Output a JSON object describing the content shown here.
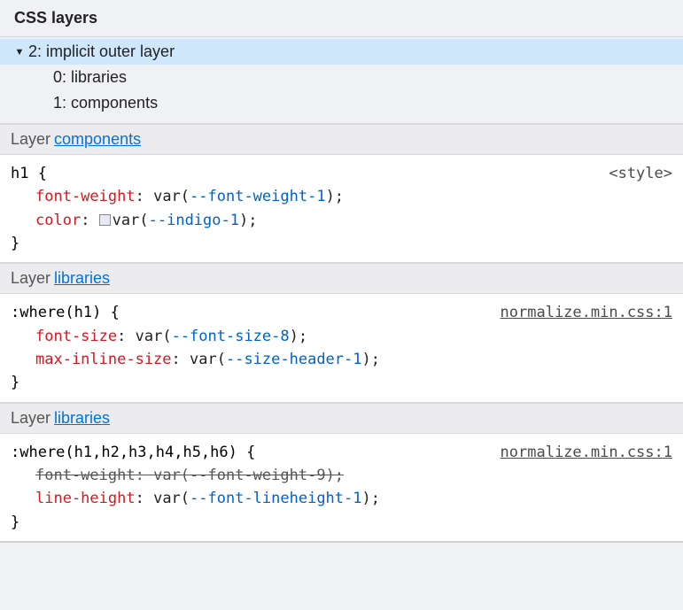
{
  "panel_title": "CSS layers",
  "tree": {
    "root": {
      "label": "2: implicit outer layer"
    },
    "children": [
      {
        "label": "0: libraries"
      },
      {
        "label": "1: components"
      }
    ]
  },
  "sections": [
    {
      "layer_prefix": "Layer ",
      "layer_name": "components",
      "selector": "h1 {",
      "source": "<style>",
      "source_kind": "tag",
      "close": "}",
      "decls": [
        {
          "prop": "font-weight",
          "val_pre": "var(",
          "var": "--font-weight-1",
          "val_post": ");",
          "swatch": false,
          "struck": false
        },
        {
          "prop": "color",
          "val_pre": "var(",
          "var": "--indigo-1",
          "val_post": ");",
          "swatch": true,
          "struck": false
        }
      ]
    },
    {
      "layer_prefix": "Layer ",
      "layer_name": "libraries",
      "selector": ":where(h1) {",
      "source": "normalize.min.css:1",
      "source_kind": "link",
      "close": "}",
      "decls": [
        {
          "prop": "font-size",
          "val_pre": "var(",
          "var": "--font-size-8",
          "val_post": ");",
          "swatch": false,
          "struck": false
        },
        {
          "prop": "max-inline-size",
          "val_pre": "var(",
          "var": "--size-header-1",
          "val_post": ");",
          "swatch": false,
          "struck": false
        }
      ]
    },
    {
      "layer_prefix": "Layer ",
      "layer_name": "libraries",
      "selector": ":where(h1,h2,h3,h4,h5,h6) {",
      "source": "normalize.min.css:1",
      "source_kind": "link",
      "close": "}",
      "decls": [
        {
          "prop": "font-weight",
          "val_pre": "var(",
          "var": "--font-weight-9",
          "val_post": ");",
          "swatch": false,
          "struck": true
        },
        {
          "prop": "line-height",
          "val_pre": "var(",
          "var": "--font-lineheight-1",
          "val_post": ");",
          "swatch": false,
          "struck": false
        }
      ]
    }
  ],
  "colon": ": "
}
